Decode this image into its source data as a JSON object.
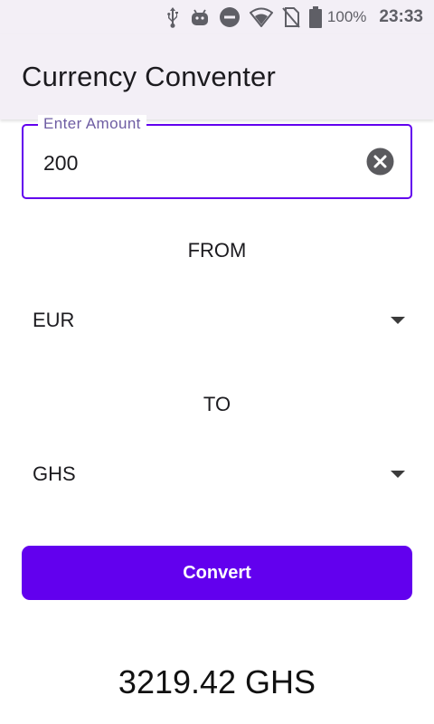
{
  "status_bar": {
    "battery": "100%",
    "time": "23:33",
    "icons": [
      "usb-icon",
      "android-debug-icon",
      "do-not-disturb-icon",
      "wifi-icon",
      "no-sim-icon",
      "battery-icon"
    ]
  },
  "app_bar": {
    "title": "Currency Conventer"
  },
  "amount_field": {
    "label": "Enter Amount",
    "value": "200",
    "clear_icon": "clear-icon"
  },
  "from_section": {
    "label": "FROM",
    "selected": "EUR"
  },
  "to_section": {
    "label": "TO",
    "selected": "GHS"
  },
  "convert_button": {
    "label": "Convert"
  },
  "result": {
    "text": "3219.42 GHS"
  },
  "colors": {
    "accent": "#6200ee",
    "app_bar_bg": "#f3eff6",
    "label": "#6e5da3"
  }
}
